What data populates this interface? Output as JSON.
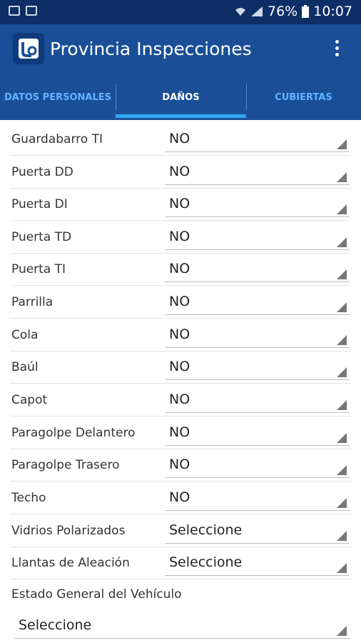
{
  "status_bar": {
    "battery": "76%",
    "time": "10:07"
  },
  "app": {
    "title": "Provincia Inspecciones"
  },
  "tabs": [
    {
      "label": "DATOS PERSONALES"
    },
    {
      "label": "DAÑOS"
    },
    {
      "label": "CUBIERTAS"
    }
  ],
  "fields": [
    {
      "label": "Guardabarro TI",
      "value": "NO"
    },
    {
      "label": "Puerta DD",
      "value": "NO"
    },
    {
      "label": "Puerta DI",
      "value": "NO"
    },
    {
      "label": "Puerta TD",
      "value": "NO"
    },
    {
      "label": "Puerta TI",
      "value": "NO"
    },
    {
      "label": "Parrilla",
      "value": "NO"
    },
    {
      "label": "Cola",
      "value": "NO"
    },
    {
      "label": "Baúl",
      "value": "NO"
    },
    {
      "label": "Capot",
      "value": "NO"
    },
    {
      "label": "Paragolpe Delantero",
      "value": "NO"
    },
    {
      "label": "Paragolpe Trasero",
      "value": "NO"
    },
    {
      "label": "Techo",
      "value": "NO"
    },
    {
      "label": "Vidrios Polarizados",
      "value": "Seleccione"
    },
    {
      "label": "Llantas de Aleación",
      "value": "Seleccione"
    }
  ],
  "estado": {
    "label": "Estado General del Vehículo",
    "value": "Seleccione"
  }
}
